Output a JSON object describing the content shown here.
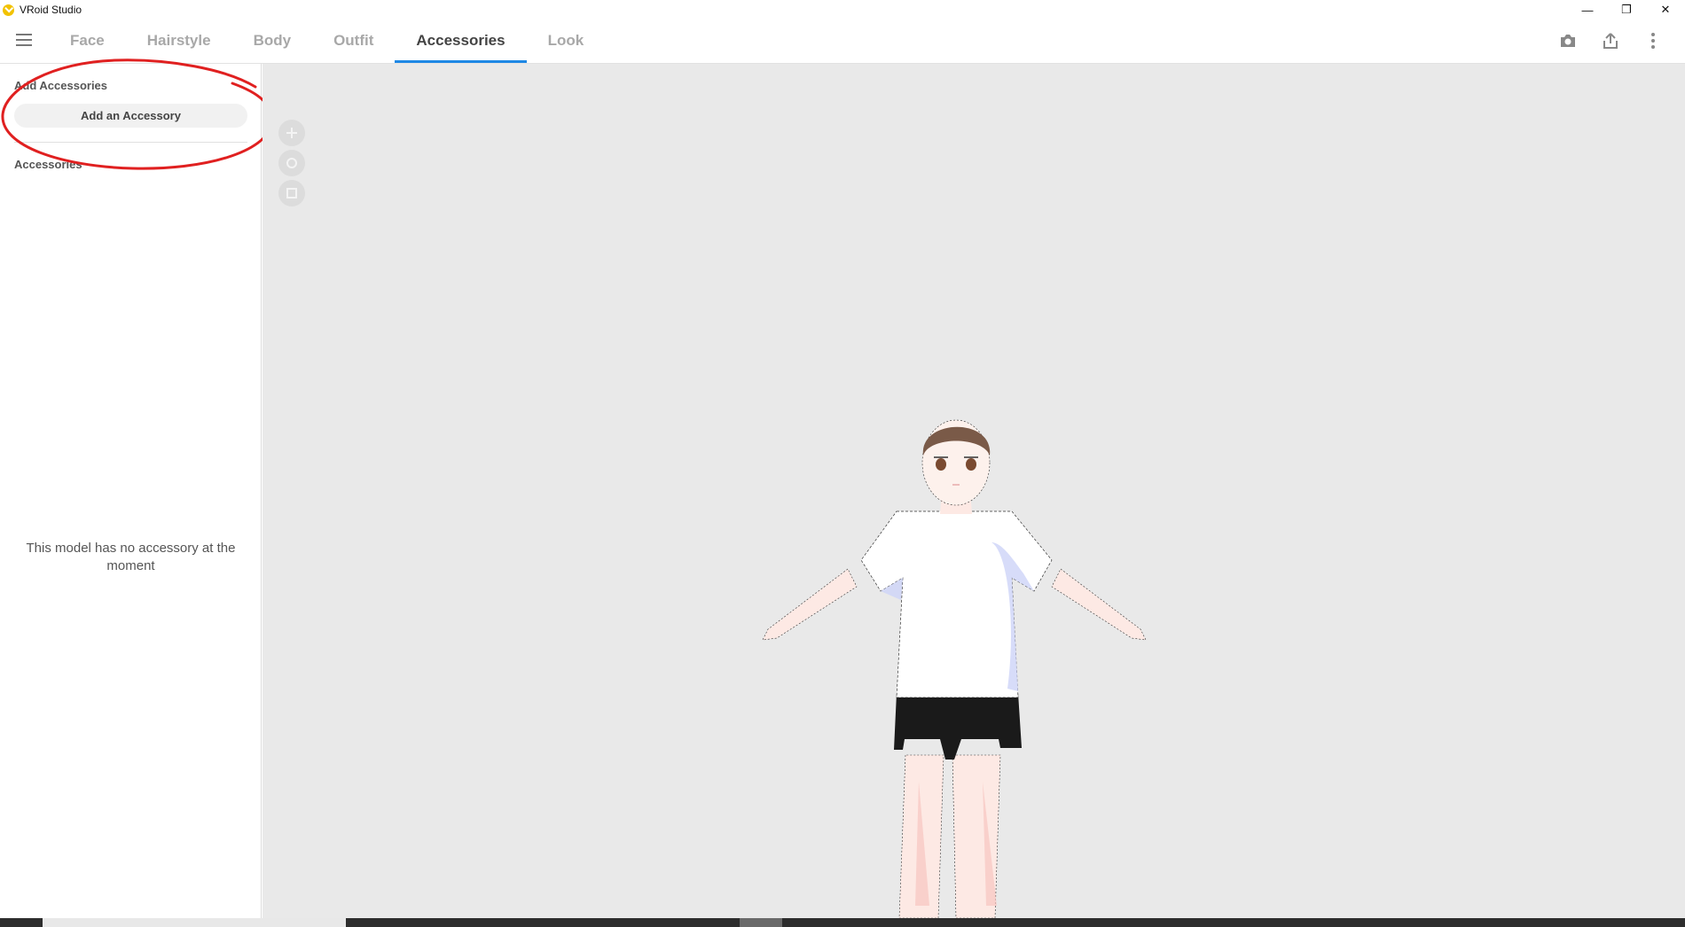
{
  "window": {
    "title": "VRoid Studio",
    "minimize_glyph": "—",
    "restore_glyph": "❐",
    "close_glyph": "✕"
  },
  "nav": {
    "tabs": [
      {
        "label": "Face",
        "active": false
      },
      {
        "label": "Hairstyle",
        "active": false
      },
      {
        "label": "Body",
        "active": false
      },
      {
        "label": "Outfit",
        "active": false
      },
      {
        "label": "Accessories",
        "active": true
      },
      {
        "label": "Look",
        "active": false
      }
    ],
    "active_color": "#1e88e5"
  },
  "sidebar": {
    "add_section_label": "Add Accessories",
    "add_button_label": "Add an Accessory",
    "list_section_label": "Accessories",
    "empty_message": "This model has no accessory at the moment"
  },
  "annotation": {
    "color": "#e02020"
  },
  "icons": {
    "menu": "hamburger-menu-icon",
    "camera": "camera-icon",
    "export": "export-icon",
    "more": "more-vertical-icon",
    "move": "move-icon",
    "rotate": "rotate-icon",
    "zoom": "zoom-icon"
  }
}
